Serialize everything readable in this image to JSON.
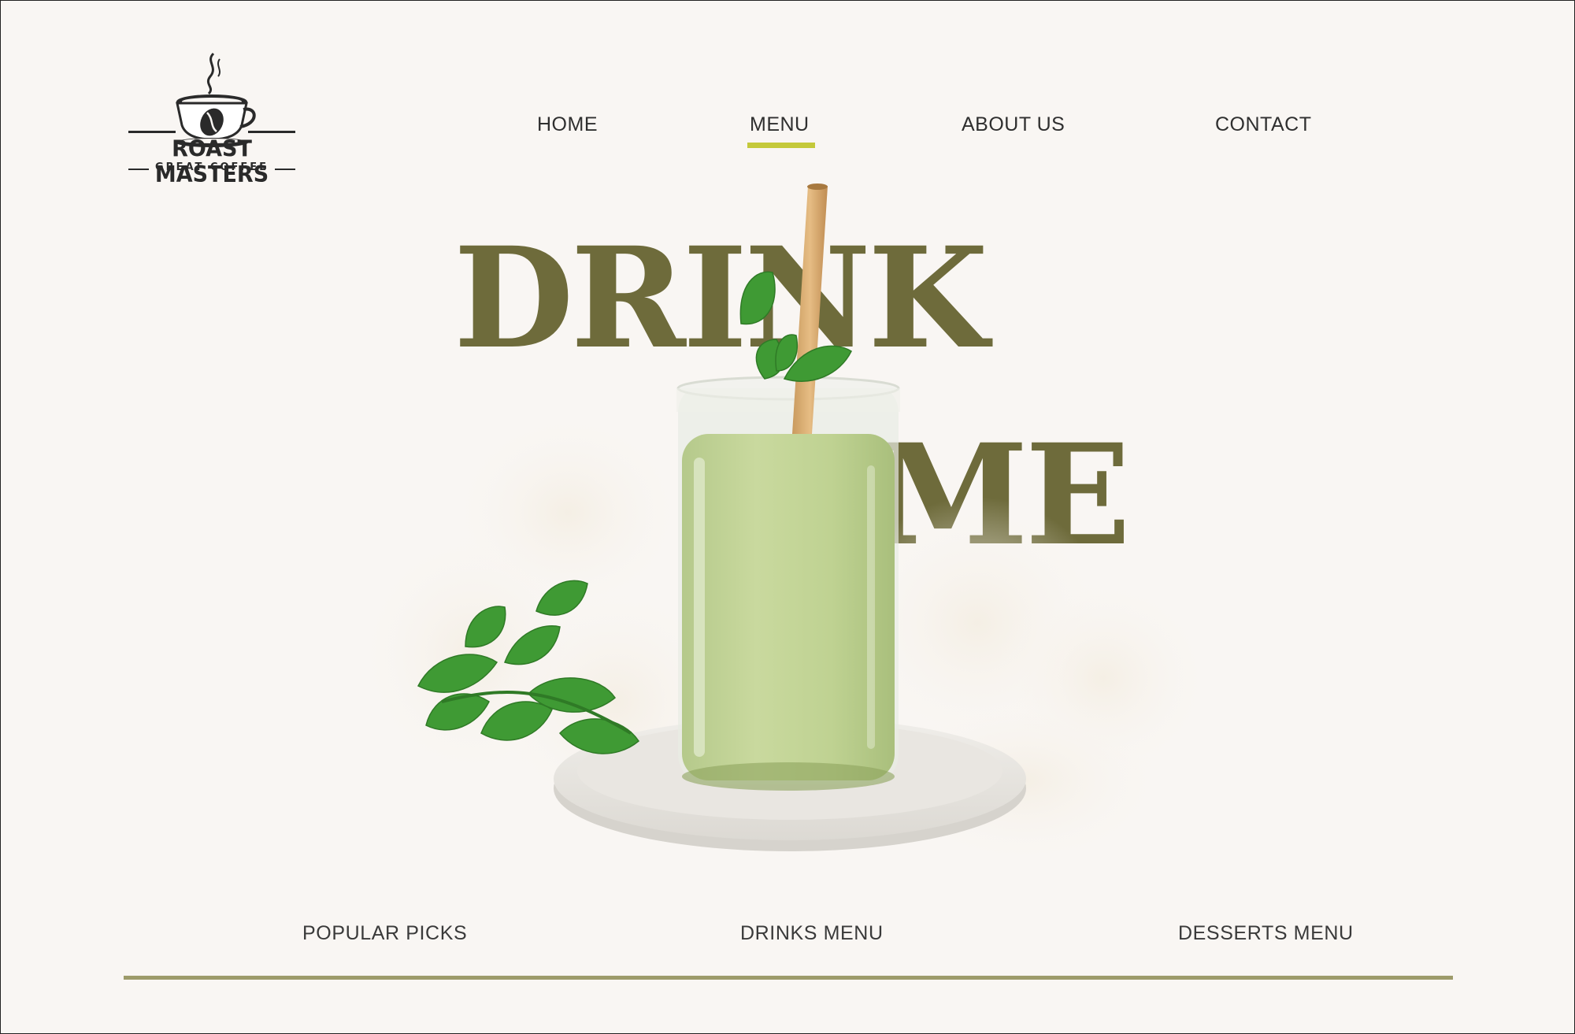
{
  "brand": {
    "name": "ROAST MASTERS",
    "tagline": "GREAT COFFEE",
    "logo_icon": "coffee-cup-icon"
  },
  "nav": {
    "items": [
      {
        "label": "HOME",
        "active": false
      },
      {
        "label": "MENU",
        "active": true
      },
      {
        "label": "ABOUT US",
        "active": false
      },
      {
        "label": "CONTACT",
        "active": false
      }
    ],
    "active_color": "#c4c93b"
  },
  "hero": {
    "line1": "DRINK",
    "line2": "ME",
    "text_color": "#6e6b3b",
    "image": "matcha-latte-glass-with-mint"
  },
  "submenu": {
    "items": [
      {
        "label": "POPULAR  PICKS"
      },
      {
        "label": "DRINKS MENU"
      },
      {
        "label": "DESSERTS MENU"
      }
    ],
    "line_color": "#9d9b6a"
  }
}
